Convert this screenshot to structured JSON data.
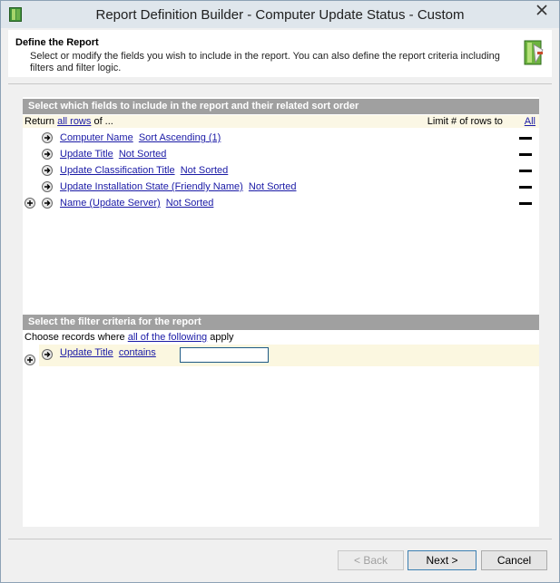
{
  "window": {
    "title": "Report Definition Builder - Computer Update Status - Custom"
  },
  "header": {
    "title": "Define the Report",
    "description": "Select or modify the fields you wish to include in the report. You can also define the report criteria including filters and filter logic."
  },
  "fields_section": {
    "heading": "Select which fields to include in the report and their related sort order",
    "return_prefix": "Return",
    "return_link": "all rows",
    "return_suffix": "of ...",
    "limit_label": "Limit # of rows to",
    "limit_link": "All",
    "rows": [
      {
        "field": "Computer Name",
        "sort": "Sort Ascending (1)"
      },
      {
        "field": "Update Title",
        "sort": "Not Sorted"
      },
      {
        "field": "Update Classification Title",
        "sort": "Not Sorted"
      },
      {
        "field": "Update Installation State (Friendly Name)",
        "sort": "Not Sorted"
      },
      {
        "field": "Name (Update Server)",
        "sort": "Not Sorted"
      }
    ]
  },
  "filter_section": {
    "heading": "Select the filter criteria for the report",
    "choose_prefix": "Choose records where",
    "choose_link": "all of the following",
    "choose_suffix": "apply",
    "filter": {
      "field": "Update Title",
      "operator": "contains",
      "value": ""
    }
  },
  "buttons": {
    "back": "< Back",
    "next": "Next >",
    "cancel": "Cancel"
  },
  "colors": {
    "accent": "#1a1aa6",
    "section_header": "#a0a0a0",
    "highlight": "#fbf7e0"
  },
  "icons": [
    "app-book-icon",
    "close-icon",
    "report-book-icon",
    "arrow-right-icon",
    "plus-icon",
    "dash-icon"
  ]
}
